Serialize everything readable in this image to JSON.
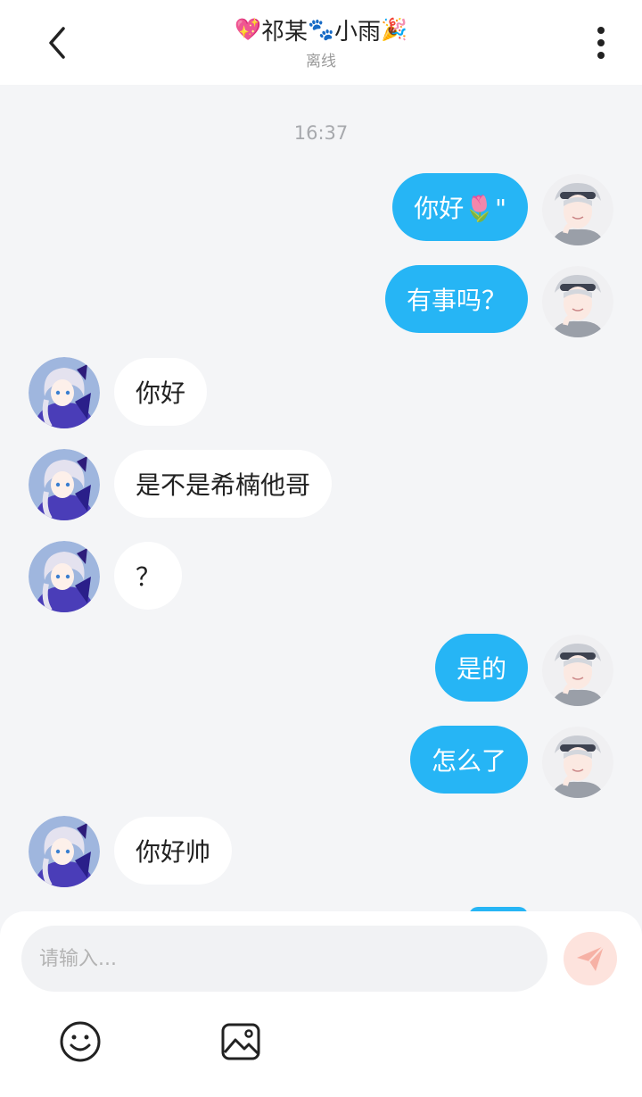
{
  "header": {
    "title_emoji_left": "💖",
    "title_part1": "祁某",
    "title_emoji_mid": "🐾",
    "title_part2": "小雨",
    "title_emoji_right": "🎉",
    "status": "离线"
  },
  "chat": {
    "timestamp": "16:37",
    "messages": [
      {
        "side": "me",
        "text": "你好🌷\""
      },
      {
        "side": "me",
        "text": "有事吗？"
      },
      {
        "side": "them",
        "text": "你好"
      },
      {
        "side": "them",
        "text": "是不是希楠他哥"
      },
      {
        "side": "them",
        "text": "？"
      },
      {
        "side": "me",
        "text": "是的"
      },
      {
        "side": "me",
        "text": "怎么了"
      },
      {
        "side": "them",
        "text": "你好帅"
      }
    ]
  },
  "composer": {
    "placeholder": "请输入..."
  },
  "icons": {
    "back": "chevron-left-icon",
    "more": "more-vertical-icon",
    "send": "send-icon",
    "emoji": "smiley-icon",
    "image": "image-icon"
  },
  "colors": {
    "my_bubble": "#26b5f5",
    "their_bubble": "#ffffff",
    "background": "#f4f5f7",
    "send_button_bg": "#fde3dd",
    "send_icon": "#f6b1a5"
  }
}
